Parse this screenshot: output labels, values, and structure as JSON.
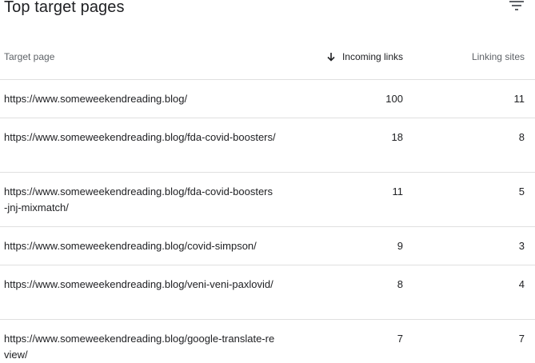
{
  "title": "Top target pages",
  "filter_icon": "filter-list-icon",
  "columns": {
    "target_page": "Target page",
    "incoming_links": "Incoming links",
    "linking_sites": "Linking sites",
    "sort_icon": "arrow-down-icon"
  },
  "rows": [
    {
      "url": "https://www.someweekendreading.blog/",
      "incoming": "100",
      "sites": "11"
    },
    {
      "url": "https://www.someweekendreading.blog/fda-covid-boosters/",
      "incoming": "18",
      "sites": "8"
    },
    {
      "url": "https://www.someweekendreading.blog/fda-covid-boosters-jnj-mixmatch/",
      "incoming": "11",
      "sites": "5"
    },
    {
      "url": "https://www.someweekendreading.blog/covid-simpson/",
      "incoming": "9",
      "sites": "3"
    },
    {
      "url": "https://www.someweekendreading.blog/veni-veni-paxlovid/",
      "incoming": "8",
      "sites": "4"
    },
    {
      "url": "https://www.someweekendreading.blog/google-translate-review/",
      "incoming": "7",
      "sites": "7"
    }
  ]
}
